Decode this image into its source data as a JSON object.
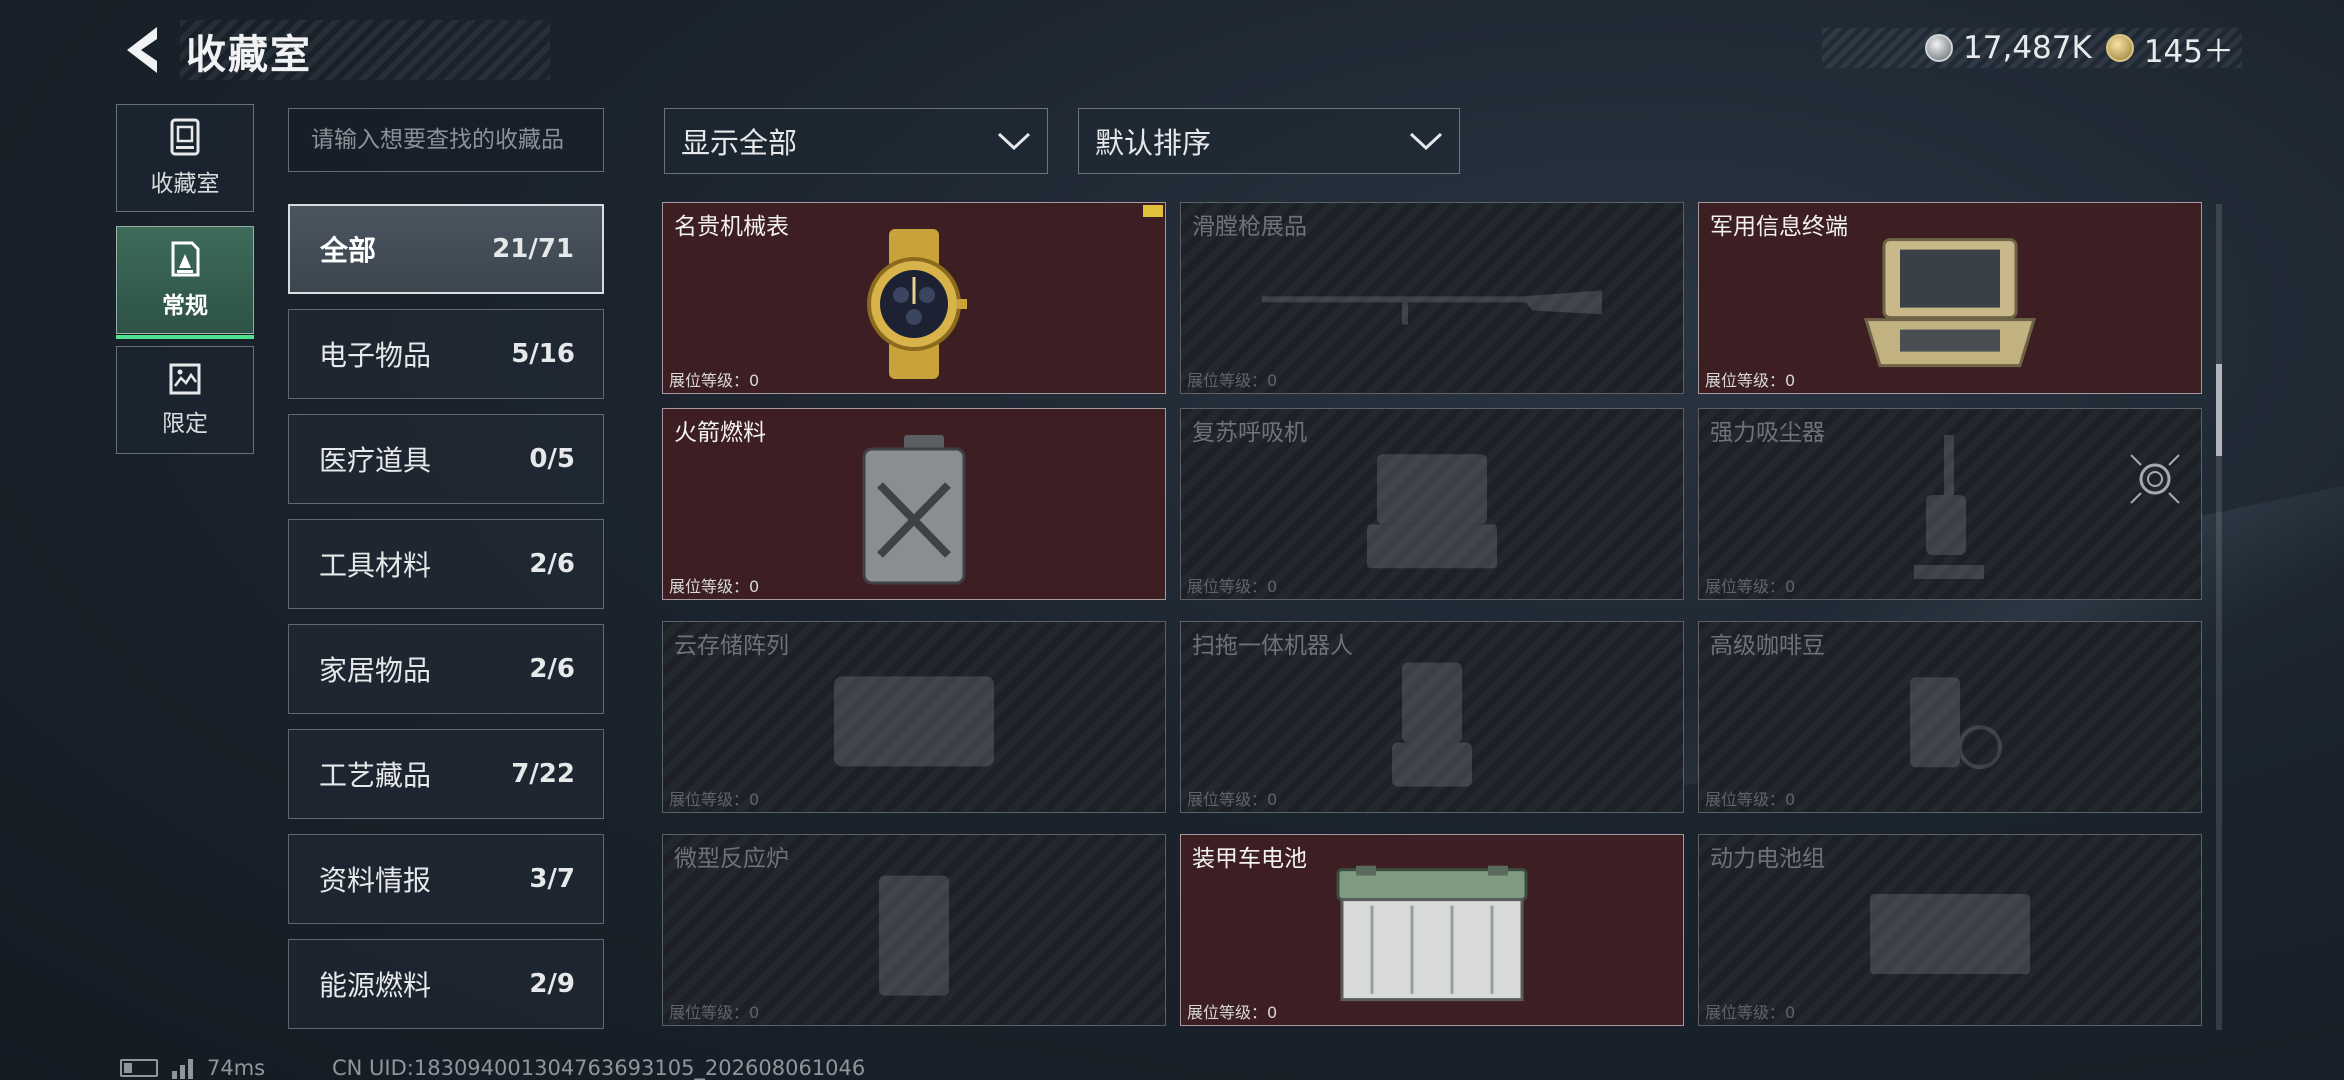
{
  "header": {
    "title": "收藏室",
    "currency": [
      {
        "icon": "silver-coin-icon",
        "value": "17,487K"
      },
      {
        "icon": "gold-coin-icon",
        "value": "145＋"
      }
    ]
  },
  "side_tabs": [
    {
      "label": "收藏室",
      "icon": "vault-icon",
      "active": false
    },
    {
      "label": "常规",
      "icon": "regular-collection-icon",
      "active": true
    },
    {
      "label": "限定",
      "icon": "limited-collection-icon",
      "active": false
    }
  ],
  "search": {
    "placeholder": "请输入想要查找的收藏品"
  },
  "categories": [
    {
      "name": "全部",
      "count": "21/71",
      "active": true
    },
    {
      "name": "电子物品",
      "count": "5/16"
    },
    {
      "name": "医疗道具",
      "count": "0/5"
    },
    {
      "name": "工具材料",
      "count": "2/6"
    },
    {
      "name": "家居物品",
      "count": "2/6"
    },
    {
      "name": "工艺藏品",
      "count": "7/22"
    },
    {
      "name": "资料情报",
      "count": "3/7"
    },
    {
      "name": "能源燃料",
      "count": "2/9"
    }
  ],
  "filters": {
    "display": "显示全部",
    "sort": "默认排序"
  },
  "items": [
    {
      "name": "名贵机械表",
      "level": "展位等级：0",
      "owned": true,
      "icon": "gold-watch-icon"
    },
    {
      "name": "滑膛枪展品",
      "level": "展位等级：0",
      "owned": false,
      "icon": "musket-icon"
    },
    {
      "name": "军用信息终端",
      "level": "展位等级：0",
      "owned": true,
      "icon": "military-terminal-icon"
    },
    {
      "name": "火箭燃料",
      "level": "展位等级：0",
      "owned": true,
      "icon": "fuel-canister-icon"
    },
    {
      "name": "复苏呼吸机",
      "level": "展位等级：0",
      "owned": false,
      "icon": "ventilator-icon"
    },
    {
      "name": "强力吸尘器",
      "level": "展位等级：0",
      "owned": false,
      "icon": "vacuum-icon"
    },
    {
      "name": "云存储阵列",
      "level": "展位等级：0",
      "owned": false,
      "icon": "storage-array-icon"
    },
    {
      "name": "扫拖一体机器人",
      "level": "展位等级：0",
      "owned": false,
      "icon": "robot-icon"
    },
    {
      "name": "高级咖啡豆",
      "level": "展位等级：0",
      "owned": false,
      "icon": "coffee-icon"
    },
    {
      "name": "微型反应炉",
      "level": "展位等级：0",
      "owned": false,
      "icon": "reactor-icon"
    },
    {
      "name": "装甲车电池",
      "level": "展位等级：0",
      "owned": true,
      "icon": "battery-icon"
    },
    {
      "name": "动力电池组",
      "level": "展位等级：0",
      "owned": false,
      "icon": "battery-pack-icon"
    }
  ],
  "status_bar": {
    "ping": "74ms",
    "uid": "CN UID:183094001304763693105_202608061046"
  },
  "colors": {
    "owned_card": "#3d1e22",
    "active_tab": "#3e6b5a",
    "active_underline": "#4ee08a"
  }
}
